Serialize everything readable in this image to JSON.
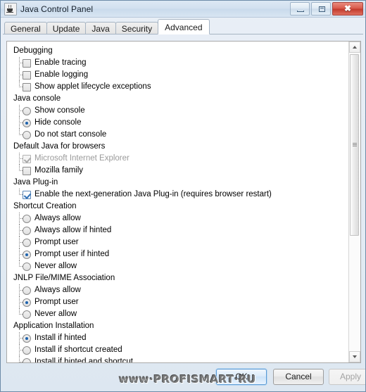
{
  "window": {
    "title": "Java Control Panel",
    "icon": "java-cup-icon",
    "minimize_label": "Minimize",
    "maximize_label": "Maximize",
    "close_label": "✖"
  },
  "tabs": [
    {
      "label": "General",
      "selected": false
    },
    {
      "label": "Update",
      "selected": false
    },
    {
      "label": "Java",
      "selected": false
    },
    {
      "label": "Security",
      "selected": false
    },
    {
      "label": "Advanced",
      "selected": true
    }
  ],
  "tree": [
    {
      "type": "group",
      "label": "Debugging"
    },
    {
      "type": "checkbox",
      "label": "Enable tracing",
      "checked": false,
      "disabled": false,
      "last": false
    },
    {
      "type": "checkbox",
      "label": "Enable logging",
      "checked": false,
      "disabled": false,
      "last": false
    },
    {
      "type": "checkbox",
      "label": "Show applet lifecycle exceptions",
      "checked": false,
      "disabled": false,
      "last": true
    },
    {
      "type": "group",
      "label": "Java console"
    },
    {
      "type": "radio",
      "label": "Show console",
      "checked": false,
      "disabled": false,
      "last": false
    },
    {
      "type": "radio",
      "label": "Hide console",
      "checked": true,
      "disabled": false,
      "last": false
    },
    {
      "type": "radio",
      "label": "Do not start console",
      "checked": false,
      "disabled": false,
      "last": true
    },
    {
      "type": "group",
      "label": "Default Java for browsers"
    },
    {
      "type": "checkbox",
      "label": "Microsoft Internet Explorer",
      "checked": true,
      "disabled": true,
      "last": false
    },
    {
      "type": "checkbox",
      "label": "Mozilla family",
      "checked": false,
      "disabled": false,
      "last": true
    },
    {
      "type": "group",
      "label": "Java Plug-in"
    },
    {
      "type": "checkbox",
      "label": "Enable the next-generation Java Plug-in (requires browser restart)",
      "checked": true,
      "disabled": false,
      "last": true
    },
    {
      "type": "group",
      "label": "Shortcut Creation"
    },
    {
      "type": "radio",
      "label": "Always allow",
      "checked": false,
      "disabled": false,
      "last": false
    },
    {
      "type": "radio",
      "label": "Always allow if hinted",
      "checked": false,
      "disabled": false,
      "last": false
    },
    {
      "type": "radio",
      "label": "Prompt user",
      "checked": false,
      "disabled": false,
      "last": false
    },
    {
      "type": "radio",
      "label": "Prompt user if hinted",
      "checked": true,
      "disabled": false,
      "last": false
    },
    {
      "type": "radio",
      "label": "Never allow",
      "checked": false,
      "disabled": false,
      "last": true
    },
    {
      "type": "group",
      "label": "JNLP File/MIME Association"
    },
    {
      "type": "radio",
      "label": "Always allow",
      "checked": false,
      "disabled": false,
      "last": false
    },
    {
      "type": "radio",
      "label": "Prompt user",
      "checked": true,
      "disabled": false,
      "last": false
    },
    {
      "type": "radio",
      "label": "Never allow",
      "checked": false,
      "disabled": false,
      "last": true
    },
    {
      "type": "group",
      "label": "Application Installation"
    },
    {
      "type": "radio",
      "label": "Install if hinted",
      "checked": true,
      "disabled": false,
      "last": false
    },
    {
      "type": "radio",
      "label": "Install if shortcut created",
      "checked": false,
      "disabled": false,
      "last": false
    },
    {
      "type": "radio",
      "label": "Install if hinted and shortcut",
      "checked": false,
      "disabled": false,
      "last": false
    }
  ],
  "scrollbar": {
    "up_arrow": "scroll-up-arrow",
    "down_arrow": "scroll-down-arrow",
    "thumb_position": "top"
  },
  "footer": {
    "ok_label": "OK",
    "cancel_label": "Cancel",
    "apply_label": "Apply",
    "apply_disabled": true
  },
  "watermark": {
    "text": "www·PROFISMART·RU"
  },
  "colors": {
    "accent": "#1d62ad",
    "title_bar": "#d2e0ef",
    "close_button": "#c1392c",
    "panel_bg": "#ffffff",
    "dialog_bg": "#e3ecf5"
  }
}
